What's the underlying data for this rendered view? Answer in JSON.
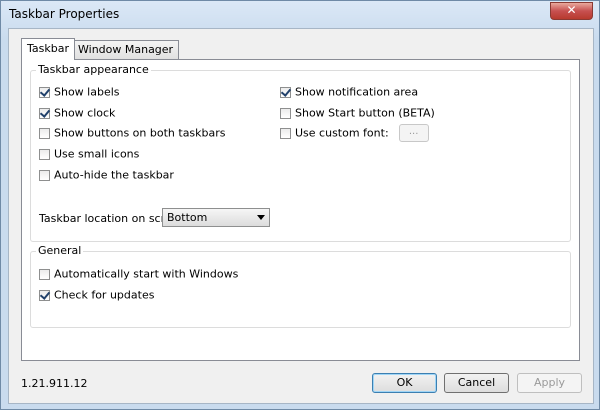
{
  "window": {
    "title": "Taskbar Properties",
    "close_glyph": "✕"
  },
  "tabs": [
    {
      "label": "Taskbar"
    },
    {
      "label": "Window Manager"
    }
  ],
  "appearance": {
    "group_label": "Taskbar appearance",
    "show_labels": {
      "label": "Show labels",
      "checked": true
    },
    "show_clock": {
      "label": "Show clock",
      "checked": true
    },
    "show_buttons_both": {
      "label": "Show buttons on both taskbars",
      "checked": false
    },
    "small_icons": {
      "label": "Use small icons",
      "checked": false
    },
    "auto_hide": {
      "label": "Auto-hide the taskbar",
      "checked": false
    },
    "show_notification": {
      "label": "Show notification area",
      "checked": true
    },
    "show_start": {
      "label": "Show Start button (BETA)",
      "checked": false
    },
    "custom_font": {
      "label": "Use custom font:",
      "checked": false,
      "button_label": "..."
    },
    "location_label": "Taskbar location on screen",
    "location_value": "Bottom"
  },
  "general": {
    "group_label": "General",
    "auto_start": {
      "label": "Automatically start with Windows",
      "checked": false
    },
    "check_updates": {
      "label": "Check for updates",
      "checked": true
    }
  },
  "footer": {
    "version": "1.21.911.12",
    "ok_label": "OK",
    "cancel_label": "Cancel",
    "apply_label": "Apply"
  }
}
